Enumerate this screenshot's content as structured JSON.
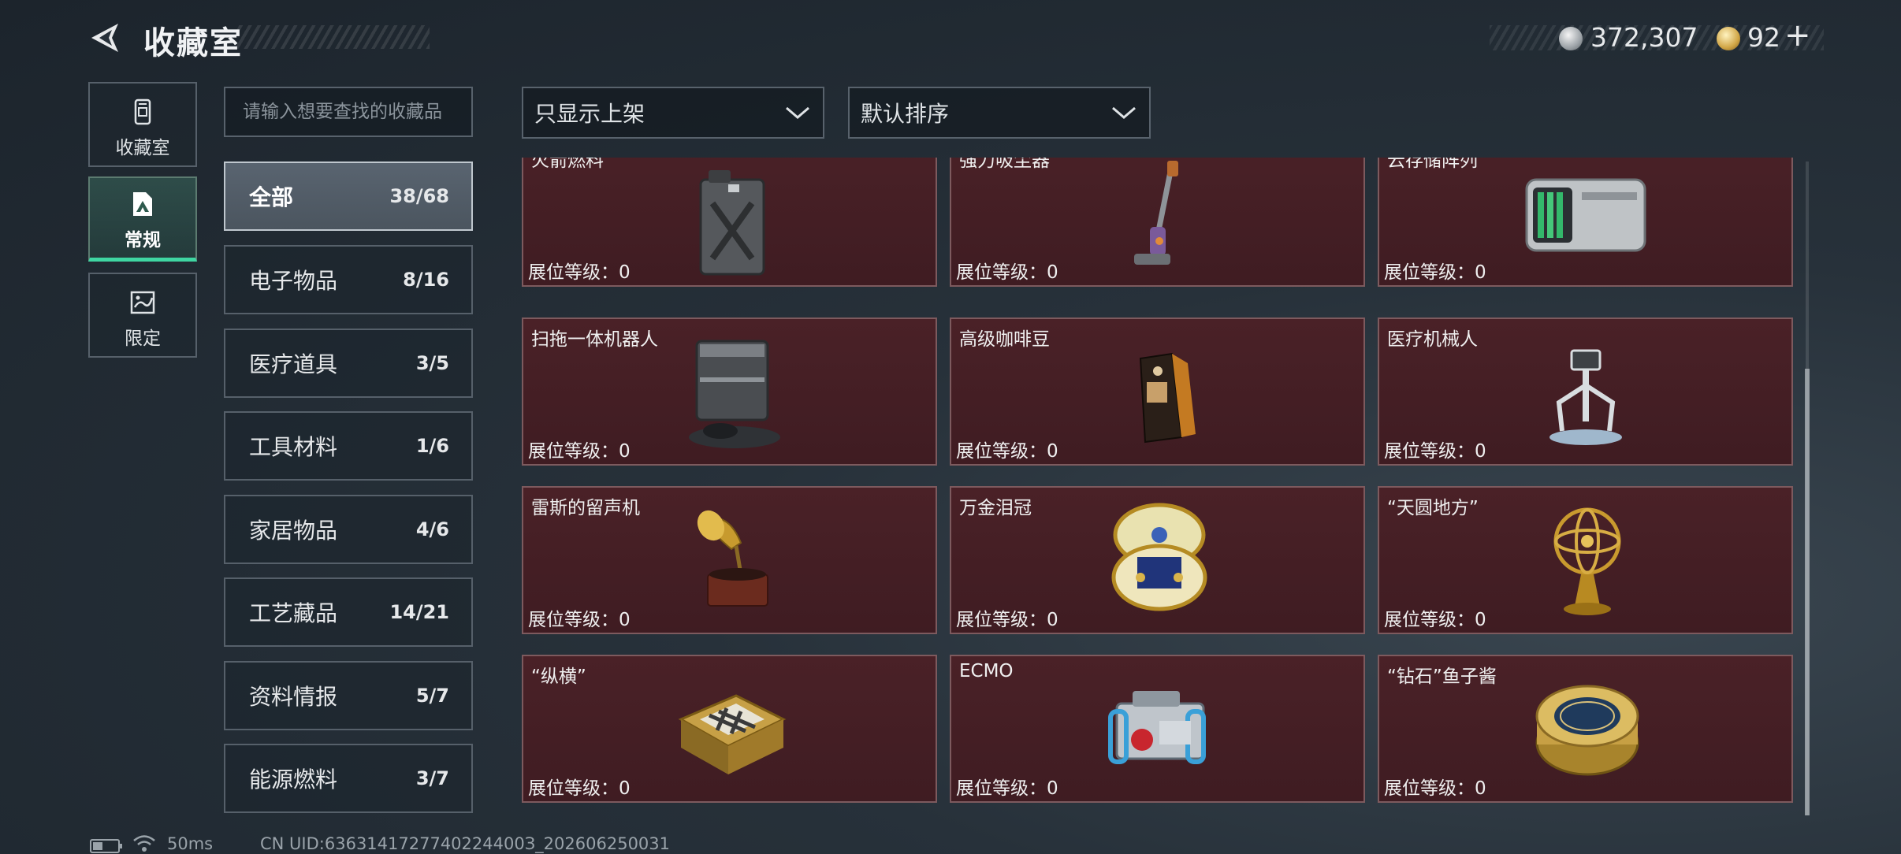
{
  "header": {
    "title": "收藏室",
    "currencies": [
      {
        "name": "silver-coin",
        "value": "372,307"
      },
      {
        "name": "gold-coin",
        "value": "92"
      }
    ],
    "add_label": "+"
  },
  "nav": {
    "tabs": [
      {
        "label": "收藏室",
        "icon": "collection-icon",
        "active": false
      },
      {
        "label": "常规",
        "icon": "regular-icon",
        "active": true
      },
      {
        "label": "限定",
        "icon": "limited-icon",
        "active": false
      }
    ]
  },
  "search": {
    "placeholder": "请输入想要查找的收藏品"
  },
  "filters": {
    "display_filter": "只显示上架",
    "sort_order": "默认排序"
  },
  "categories": [
    {
      "label": "全部",
      "count": "38/68",
      "active": true
    },
    {
      "label": "电子物品",
      "count": "8/16",
      "active": false
    },
    {
      "label": "医疗道具",
      "count": "3/5",
      "active": false
    },
    {
      "label": "工具材料",
      "count": "1/6",
      "active": false
    },
    {
      "label": "家居物品",
      "count": "4/6",
      "active": false
    },
    {
      "label": "工艺藏品",
      "count": "14/21",
      "active": false
    },
    {
      "label": "资料情报",
      "count": "5/7",
      "active": false
    },
    {
      "label": "能源燃料",
      "count": "3/7",
      "active": false
    }
  ],
  "level_label": "展位等级：",
  "items": [
    {
      "name": "火箭燃料",
      "level": "0",
      "icon": "fuel-canister-icon"
    },
    {
      "name": "强力吸尘器",
      "level": "0",
      "icon": "vacuum-cleaner-icon"
    },
    {
      "name": "云存储阵列",
      "level": "0",
      "icon": "storage-array-icon"
    },
    {
      "name": "扫拖一体机器人",
      "level": "0",
      "icon": "robot-mop-icon"
    },
    {
      "name": "高级咖啡豆",
      "level": "0",
      "icon": "coffee-bag-icon"
    },
    {
      "name": "医疗机械人",
      "level": "0",
      "icon": "medical-robot-icon"
    },
    {
      "name": "雷斯的留声机",
      "level": "0",
      "icon": "gramophone-icon"
    },
    {
      "name": "万金泪冠",
      "level": "0",
      "icon": "jeweled-egg-icon"
    },
    {
      "name": "“天圆地方”",
      "level": "0",
      "icon": "armillary-sphere-icon"
    },
    {
      "name": "“纵横”",
      "level": "0",
      "icon": "chess-box-icon"
    },
    {
      "name": "ECMO",
      "level": "0",
      "icon": "ecmo-machine-icon"
    },
    {
      "name": "“钻石”鱼子酱",
      "level": "0",
      "icon": "caviar-tin-icon"
    }
  ],
  "status_bar": {
    "ping": "50ms",
    "uid": "CN UID:6363141727740224400З_202606250031"
  }
}
